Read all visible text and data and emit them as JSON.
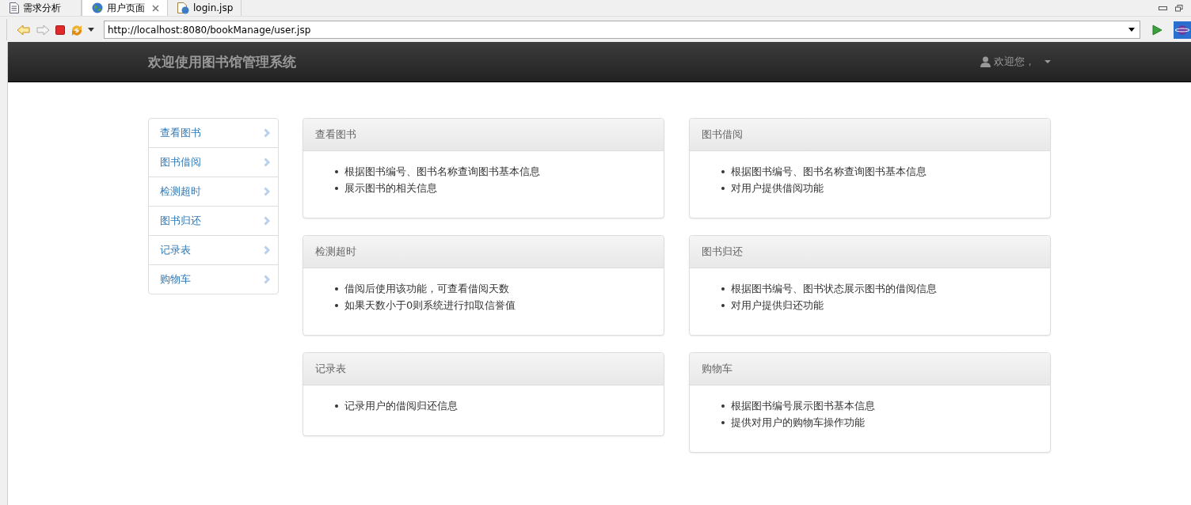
{
  "editor_tabs": [
    {
      "label": "需求分析",
      "kind": "doc",
      "selected": false,
      "closable": false
    },
    {
      "label": "用户页面",
      "kind": "globe",
      "selected": true,
      "closable": true
    },
    {
      "label": "login.jsp",
      "kind": "jsp",
      "selected": false,
      "closable": false
    }
  ],
  "browser": {
    "url": "http://localhost:8080/bookManage/user.jsp"
  },
  "navbar": {
    "brand": "欢迎使用图书馆管理系统",
    "user_menu": "欢迎您，"
  },
  "sidebar": {
    "items": [
      {
        "label": "查看图书"
      },
      {
        "label": "图书借阅"
      },
      {
        "label": "检测超时"
      },
      {
        "label": "图书归还"
      },
      {
        "label": "记录表"
      },
      {
        "label": "购物车"
      }
    ]
  },
  "panels": [
    {
      "title": "查看图书",
      "items": [
        "根据图书编号、图书名称查询图书基本信息",
        "展示图书的相关信息"
      ]
    },
    {
      "title": "图书借阅",
      "items": [
        "根据图书编号、图书名称查询图书基本信息",
        "对用户提供借阅功能"
      ]
    },
    {
      "title": "检测超时",
      "items": [
        "借阅后使用该功能，可查看借阅天数",
        "如果天数小于0则系统进行扣取信誉值"
      ]
    },
    {
      "title": "图书归还",
      "items": [
        "根据图书编号、图书状态展示图书的借阅信息",
        "对用户提供归还功能"
      ]
    },
    {
      "title": "记录表",
      "items": [
        "记录用户的借阅归还信息"
      ]
    },
    {
      "title": "购物车",
      "items": [
        "根据图书编号展示图书基本信息",
        "提供对用户的购物车操作功能"
      ]
    }
  ]
}
